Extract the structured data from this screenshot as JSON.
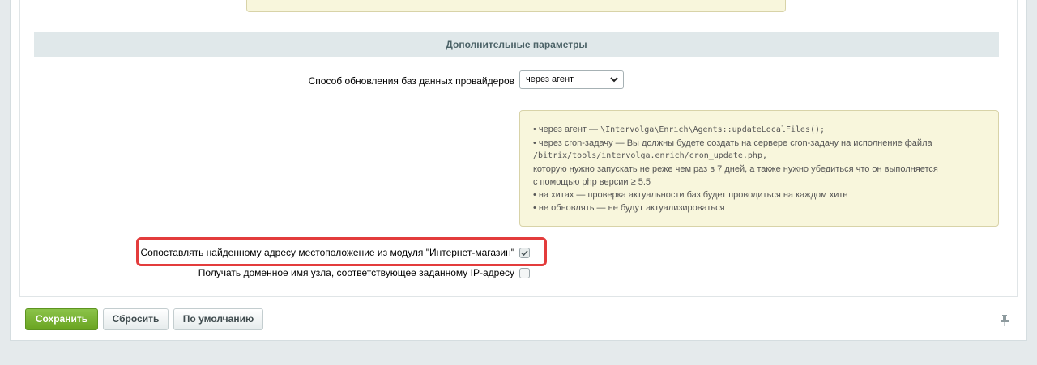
{
  "section": {
    "title": "Дополнительные параметры"
  },
  "update_method": {
    "label": "Способ обновления баз данных провайдеров",
    "selected": "через агент"
  },
  "note": {
    "line1_prefix": "• через агент — ",
    "line1_code": "\\Intervolga\\Enrich\\Agents::updateLocalFiles();",
    "line2": "• через cron-задачу — Вы должны будете создать на сервере cron-задачу на исполнение файла",
    "line3_code": "/bitrix/tools/intervolga.enrich/cron_update.php,",
    "line4": "которую нужно запускать не реже чем раз в 7 дней, а также нужно убедиться что он выполняется",
    "line5": "с помощью php версии ≥ 5.5",
    "line6": "• на хитах — проверка актуальности баз будет проводиться на каждом хите",
    "line7": "• не обновлять — не будут актуализироваться"
  },
  "options": {
    "match_location_label": "Сопоставлять найденному адресу местоположение из модуля \"Интернет-магазин\"",
    "match_location_checked": true,
    "resolve_hostname_label": "Получать доменное имя узла, соответствующее заданному IP-адресу",
    "resolve_hostname_checked": false
  },
  "footer": {
    "save_label": "Сохранить",
    "reset_label": "Сбросить",
    "default_label": "По умолчанию"
  },
  "icons": {
    "pin": "pin-icon",
    "check": "check-icon",
    "dropdown": "chevron-down-icon"
  },
  "colors": {
    "primary_button": "#6aa421",
    "highlight_border": "#e33c3c",
    "note_background": "#f8f6dc",
    "section_header_background": "#e0e8ea"
  }
}
